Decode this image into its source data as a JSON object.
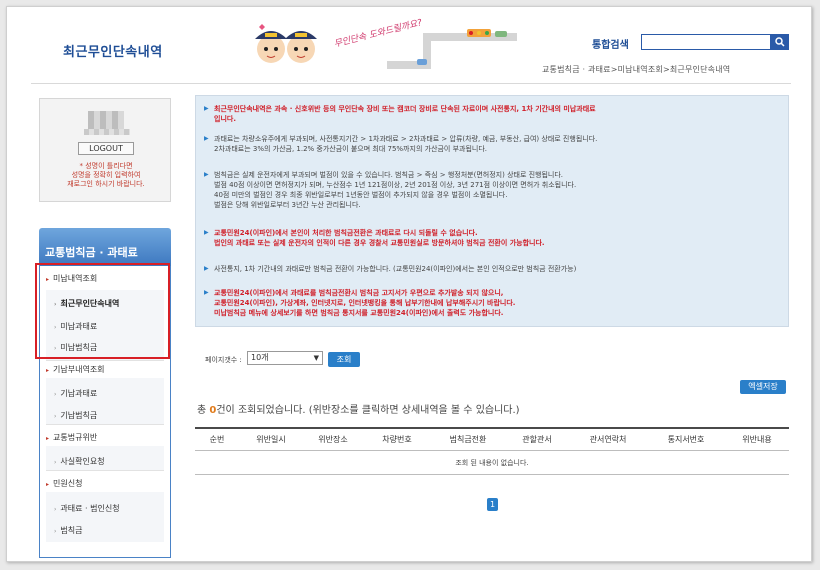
{
  "header": {
    "title": "최근무인단속내역",
    "speech": "무인단속 도와드릴까요?",
    "search_label": "통합검색",
    "search_value": "",
    "breadcrumb": "교통범칙금 · 과태료>미납내역조회>최근무인단속내역"
  },
  "login": {
    "logout_label": "LOGOUT",
    "note_1": "* 성명이 틀리다면",
    "note_2": "성명을 정확히 입력하여",
    "note_3": "재로그인 하시기 바랍니다."
  },
  "menu": {
    "head": "교통범칙금 · 과태료",
    "items": [
      {
        "label": "미납내역조회"
      },
      {
        "label": "최근무인단속내역"
      },
      {
        "label": "미납과태료"
      },
      {
        "label": "미납범칙금"
      },
      {
        "label": "기납부내역조회"
      },
      {
        "label": "기납과태료"
      },
      {
        "label": "기납범칙금"
      },
      {
        "label": "교통법규위반"
      },
      {
        "label": "사실확인요청"
      },
      {
        "label": "민원신청"
      },
      {
        "label": "과태료 · 범인신청"
      },
      {
        "label": "범칙금"
      }
    ]
  },
  "notice": {
    "n1a": "최근무인단속내역은 과속 · 신호위반 등의 무인단속 장비 또는 캠코더 장비로 단속된 자료이며 사전통지, 1차 기간내의 미납과태료",
    "n1b": "입니다.",
    "n2a": "과태료는 차량소유주에게 부과되며, 사전통지기간 > 1차과태료 > 2차과태료 > 압류(차량, 예금, 부동산, 급여) 상태로 진행됩니다.",
    "n2b": "2차과태료는 3%의 가산금, 1.2% 중가산금이 붙으며 최대 75%까지의 가산금이 부과됩니다.",
    "n3a": "범칙금은 실제 운전자에게 부과되며 벌점이 있을 수 있습니다. 범칙금 > 즉심 > 행정처분(면허정지) 상태로 진행됩니다.",
    "n3b": "벌점 40점 이상이면 면허정지가 되며, 누산점수 1년 121점이상, 2년 201점 이상, 3년 271점 이상이면 면허가 취소됩니다.",
    "n3c": "40점 미만의 벌점인 경우 최종 위반일로부터 1년동안 벌점이 추가되지 않을 경우 벌점이 소멸됩니다.",
    "n3d": "벌점은 당해 위반일로부터 3년간 누산 관리됩니다.",
    "n4a": "교통민원24(이파인)에서 본인이 처리한 범칙금전환은 과태료로 다시 되돌릴 수 없습니다.",
    "n4b": "법인의 과태료 또는 실제 운전자의 인적이 다른 경우 경찰서 교통민원실로 방문하셔야 범칙금 전환이 가능합니다.",
    "n5a": "사전통지, 1차 기간내의 과태료만 범칙금 전환이 가능합니다. (교통민원24(이파인)에서는 본인 인적으로만 범칙금 전환가능)",
    "n6a": "교통민원24(이파인)에서 과태료를 범칙금전환시 범칙금 고지서가 우편으로 추가발송 되지 않으니,",
    "n6b": "교통민원24(이파인), 가상계좌, 인터넷지로, 인터넷뱅킹을 통해 납부기한내에 납부해주시기 바랍니다.",
    "n6c": "미납범칙금 메뉴에 상세보기를 하면 범칙금 통지서를 교통민원24(이파인)에서 출력도 가능합니다."
  },
  "controls": {
    "page_count_label": "페이지갯수 :",
    "page_count_value": "10개",
    "search_button": "조회",
    "excel_button": "엑셀저장"
  },
  "result": {
    "prefix": "총 ",
    "count": "0",
    "suffix": "건이 조회되었습니다. (위반장소를 클릭하면 상세내역을 볼 수 있습니다.)"
  },
  "table": {
    "headers": [
      "순번",
      "위반일시",
      "위반장소",
      "차량번호",
      "범칙금전환",
      "관할관서",
      "관서연락처",
      "통지서번호",
      "위반내용"
    ],
    "empty_message": "조회 된 내용이 없습니다."
  },
  "pagination": {
    "current": "1"
  },
  "colors": {
    "accent": "#2a7fc9",
    "notice_bg": "#e1ecf5",
    "highlight_box": "#d81f26",
    "warning_text": "#d0202a"
  }
}
